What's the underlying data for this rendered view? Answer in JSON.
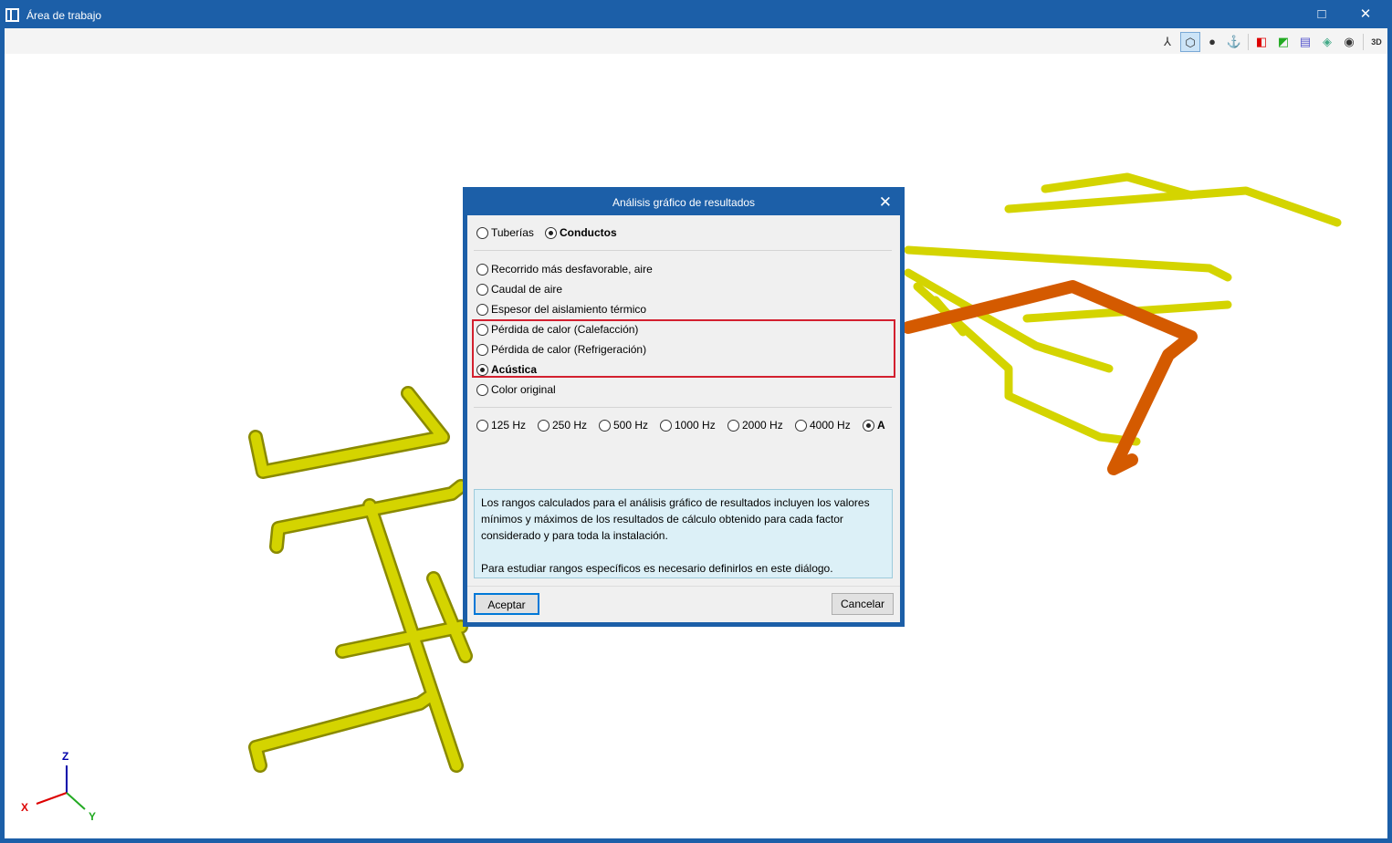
{
  "window": {
    "title": "Área de trabajo",
    "maximize_icon": "□",
    "close_icon": "✕"
  },
  "toolbar": {
    "icons": [
      "axes-icon",
      "view-cube-icon",
      "orbit-icon",
      "rotate-icon",
      "section-x-icon",
      "section-diagonal-icon",
      "section-horizontal-icon",
      "layers-icon",
      "visibility-icon",
      "3d-settings-icon"
    ],
    "label_3d": "3D"
  },
  "axes": {
    "x": "X",
    "y": "Y",
    "z": "Z"
  },
  "dialog": {
    "title": "Análisis gráfico de resultados",
    "type_options": [
      {
        "label": "Tuberías",
        "selected": false
      },
      {
        "label": "Conductos",
        "selected": true
      }
    ],
    "result_options": [
      {
        "label": "Recorrido más desfavorable, aire",
        "selected": false
      },
      {
        "label": "Caudal de aire",
        "selected": false
      },
      {
        "label": "Espesor del aislamiento térmico",
        "selected": false
      },
      {
        "label": "Pérdida de calor (Calefacción)",
        "selected": false
      },
      {
        "label": "Pérdida de calor (Refrigeración)",
        "selected": false
      },
      {
        "label": "Acústica",
        "selected": true
      },
      {
        "label": "Color original",
        "selected": false
      }
    ],
    "frequency_options": [
      {
        "label": "125 Hz",
        "selected": false
      },
      {
        "label": "250 Hz",
        "selected": false
      },
      {
        "label": "500 Hz",
        "selected": false
      },
      {
        "label": "1000 Hz",
        "selected": false
      },
      {
        "label": "2000 Hz",
        "selected": false
      },
      {
        "label": "4000 Hz",
        "selected": false
      },
      {
        "label": "A",
        "selected": true
      }
    ],
    "info_line1": "Los rangos calculados para el análisis gráfico de resultados incluyen los valores mínimos y máximos de los resultados de cálculo obtenido para cada factor considerado y para toda la instalación.",
    "info_line2": "Para estudiar rangos específicos es necesario definirlos en este diálogo.",
    "accept_label": "Aceptar",
    "cancel_label": "Cancelar",
    "close_icon": "✕"
  },
  "colors": {
    "duct_yellow": "#d4d400",
    "duct_orange": "#d45a00",
    "highlight": "#d3202f",
    "accent": "#1c5fa8"
  }
}
